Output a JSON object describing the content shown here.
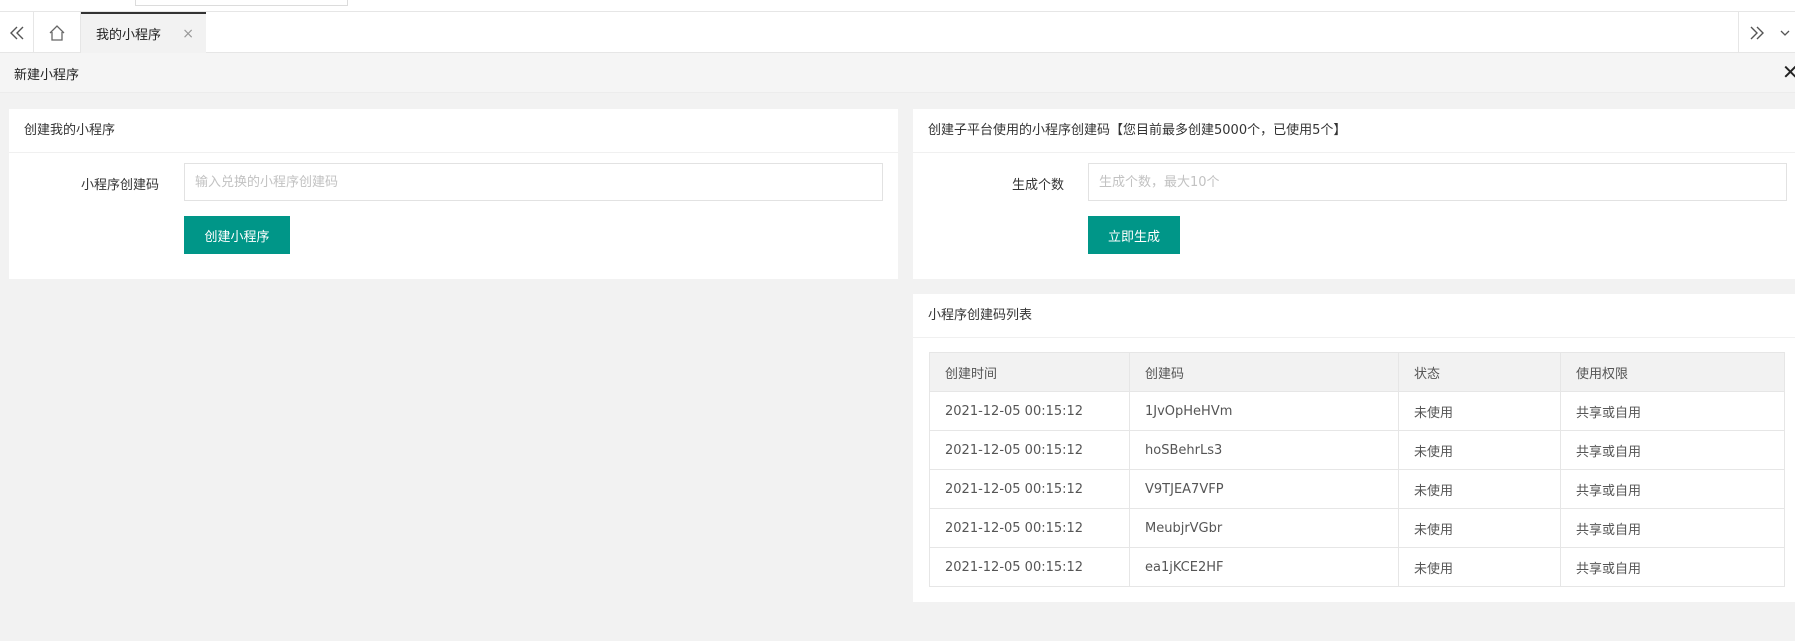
{
  "tabbar": {
    "prev_icon": "double-chevron-left-icon",
    "home_icon": "home-icon",
    "next_icon": "double-chevron-right-icon",
    "more_icon": "chevron-down-icon",
    "active_tab": {
      "label": "我的小程序",
      "close": "×"
    }
  },
  "page": {
    "title": "新建小程序",
    "close": "✕"
  },
  "create_card": {
    "title": "创建我的小程序",
    "field_label": "小程序创建码",
    "field_placeholder": "输入兑换的小程序创建码",
    "field_value": "",
    "button_label": "创建小程序"
  },
  "generate_card": {
    "title": "创建子平台使用的小程序创建码【您目前最多创建5000个，已使用5个】",
    "field_label": "生成个数",
    "field_placeholder": "生成个数，最大10个",
    "field_value": "",
    "button_label": "立即生成"
  },
  "codes_card": {
    "title": "小程序创建码列表",
    "columns": [
      "创建时间",
      "创建码",
      "状态",
      "使用权限"
    ],
    "rows": [
      [
        "2021-12-05 00:15:12",
        "1JvOpHeHVm",
        "未使用",
        "共享或自用"
      ],
      [
        "2021-12-05 00:15:12",
        "hoSBehrLs3",
        "未使用",
        "共享或自用"
      ],
      [
        "2021-12-05 00:15:12",
        "V9TJEA7VFP",
        "未使用",
        "共享或自用"
      ],
      [
        "2021-12-05 00:15:12",
        "MeubjrVGbr",
        "未使用",
        "共享或自用"
      ],
      [
        "2021-12-05 00:15:12",
        "ea1jKCE2HF",
        "未使用",
        "共享或自用"
      ]
    ]
  },
  "colors": {
    "primary_button": "#009688",
    "background": "#f2f2f2"
  }
}
